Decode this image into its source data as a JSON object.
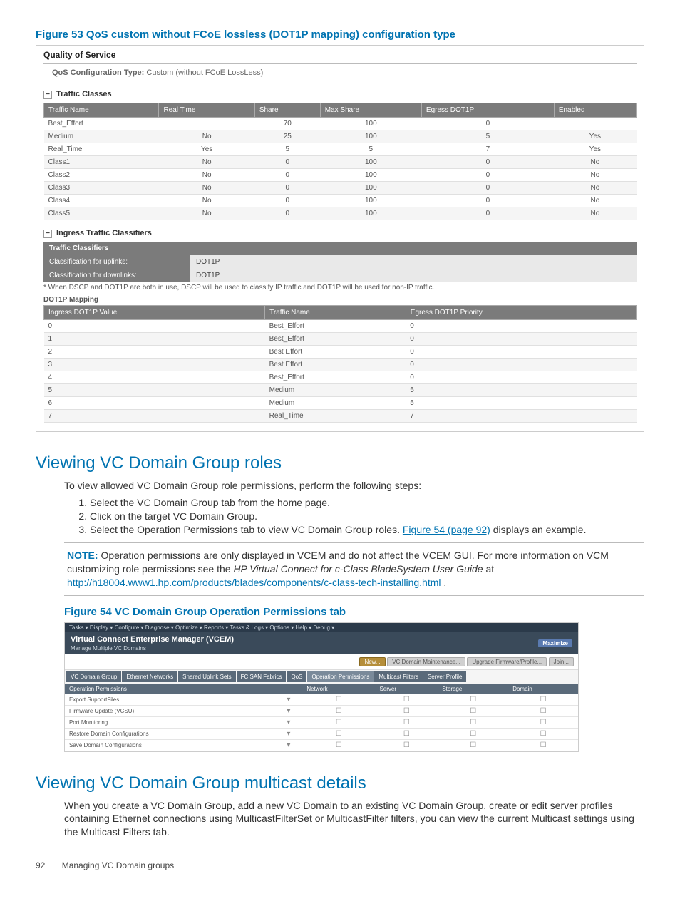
{
  "figure53": {
    "caption": "Figure 53 QoS custom without FCoE lossless (DOT1P mapping) configuration type",
    "panel_title": "Quality of Service",
    "conf_label": "QoS Configuration Type:",
    "conf_value": "Custom (without FCoE LossLess)",
    "traffic_classes_header": "Traffic Classes",
    "tc_headers": [
      "Traffic Name",
      "Real Time",
      "Share",
      "Max Share",
      "Egress DOT1P",
      "Enabled"
    ],
    "tc_rows": [
      [
        "Best_Effort",
        "",
        "70",
        "100",
        "0",
        ""
      ],
      [
        "Medium",
        "No",
        "25",
        "100",
        "5",
        "Yes"
      ],
      [
        "Real_Time",
        "Yes",
        "5",
        "5",
        "7",
        "Yes"
      ],
      [
        "Class1",
        "No",
        "0",
        "100",
        "0",
        "No"
      ],
      [
        "Class2",
        "No",
        "0",
        "100",
        "0",
        "No"
      ],
      [
        "Class3",
        "No",
        "0",
        "100",
        "0",
        "No"
      ],
      [
        "Class4",
        "No",
        "0",
        "100",
        "0",
        "No"
      ],
      [
        "Class5",
        "No",
        "0",
        "100",
        "0",
        "No"
      ]
    ],
    "ingress_header": "Ingress Traffic Classifiers",
    "classifiers_header": "Traffic Classifiers",
    "uplinks_label": "Classification for uplinks:",
    "uplinks_value": "DOT1P",
    "downlinks_label": "Classification for downlinks:",
    "downlinks_value": "DOT1P",
    "footnote": "* When DSCP and DOT1P are both in use, DSCP will be used to classify IP traffic and DOT1P will be used for non-IP traffic.",
    "mapping_header": "DOT1P Mapping",
    "map_headers": [
      "Ingress DOT1P Value",
      "Traffic Name",
      "Egress DOT1P Priority"
    ],
    "map_rows": [
      [
        "0",
        "Best_Effort",
        "0"
      ],
      [
        "1",
        "Best_Effort",
        "0"
      ],
      [
        "2",
        "Best Effort",
        "0"
      ],
      [
        "3",
        "Best Effort",
        "0"
      ],
      [
        "4",
        "Best_Effort",
        "0"
      ],
      [
        "5",
        "Medium",
        "5"
      ],
      [
        "6",
        "Medium",
        "5"
      ],
      [
        "7",
        "Real_Time",
        "7"
      ]
    ]
  },
  "section_roles": {
    "heading": "Viewing VC Domain Group roles",
    "intro": "To view allowed VC Domain Group role permissions, perform the following steps:",
    "steps": [
      "Select the VC Domain Group tab from the home page.",
      "Click on the target VC Domain Group.",
      "Select the Operation Permissions tab to view VC Domain Group roles. "
    ],
    "step3_link": "Figure 54 (page 92)",
    "step3_tail": " displays an example.",
    "note_label": "NOTE:",
    "note_text_1": "Operation permissions are only displayed in VCEM and do not affect the VCEM GUI. For more information on VCM customizing role permissions see the ",
    "note_em": "HP Virtual Connect for c-Class BladeSystem User Guide",
    "note_text_2": " at ",
    "note_link": "http://h18004.www1.hp.com/products/blades/components/c-class-tech-installing.html",
    "note_text_3": "."
  },
  "figure54": {
    "caption": "Figure 54 VC Domain Group Operation Permissions tab",
    "menu_text": "Tasks ▾   Display ▾   Configure ▾   Diagnose ▾   Optimize ▾   Reports ▾   Tasks & Logs ▾   Options ▾   Help ▾   Debug ▾",
    "app_title": "Virtual Connect Enterprise Manager (VCEM)",
    "app_sub": "Manage Multiple VC Domains",
    "maximize": "Maximize",
    "btn_new": "New...",
    "btn_mid": "VC Domain Maintenance...",
    "btn_fw": "Upgrade Firmware/Profile...",
    "btn_join": "Join...",
    "tabs": [
      "VC Domain Group",
      "Ethernet Networks",
      "Shared Uplink Sets",
      "FC SAN Fabrics",
      "QoS",
      "Operation Permissions",
      "Multicast Filters",
      "Server Profile"
    ],
    "perm_headers": [
      "Operation Permissions",
      "",
      "Network",
      "Server",
      "Storage",
      "Domain"
    ],
    "perm_rows": [
      "Export SupportFiles",
      "Firmware Update (VCSU)",
      "Port Monitoring",
      "Restore Domain Configurations",
      "Save Domain Configurations"
    ]
  },
  "section_multicast": {
    "heading": "Viewing VC Domain Group multicast details",
    "body": "When you create a VC Domain Group, add a new VC Domain to an existing VC Domain Group, create or edit server profiles containing Ethernet connections using MulticastFilterSet or MulticastFilter filters, you can view the current Multicast settings using the Multicast Filters tab."
  },
  "footer": {
    "page_num": "92",
    "chapter": "Managing VC Domain groups"
  }
}
